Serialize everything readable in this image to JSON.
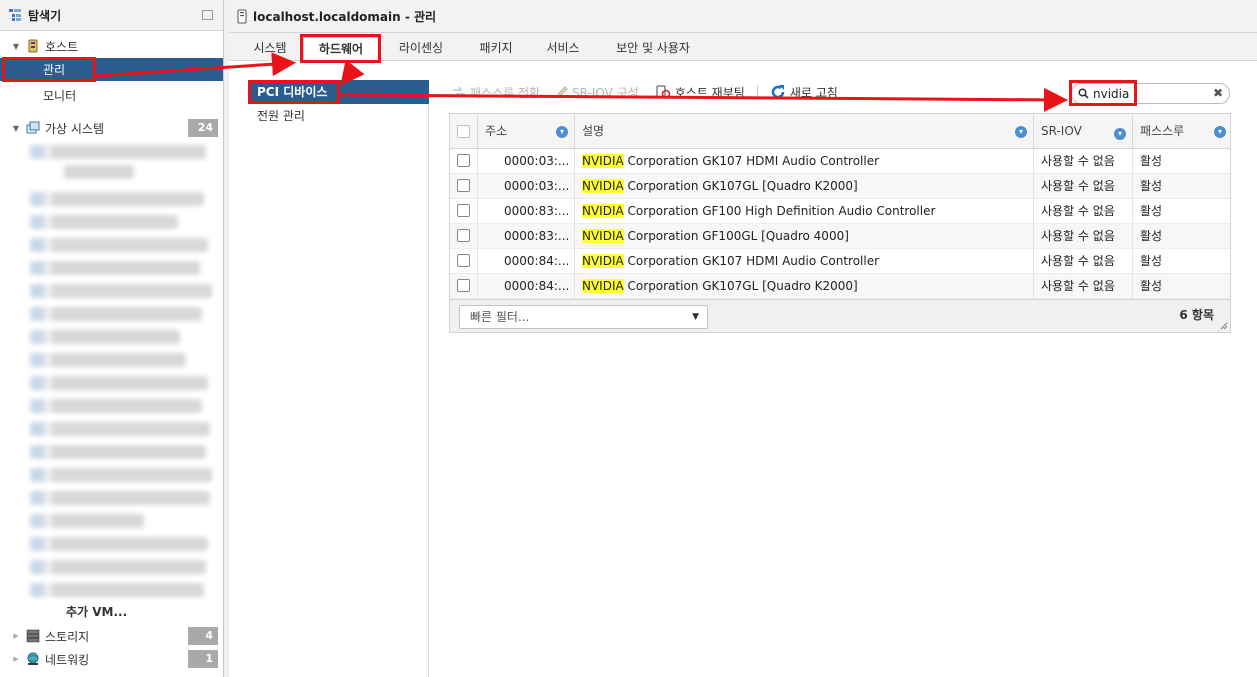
{
  "sidebar": {
    "title": "탐색기",
    "host": {
      "label": "호스트",
      "manage": "관리",
      "monitor": "모니터"
    },
    "vms": {
      "label": "가상 시스템",
      "count": "24",
      "more": "추가 VM..."
    },
    "storage": {
      "label": "스토리지",
      "count": "4"
    },
    "networking": {
      "label": "네트워킹",
      "count": "1"
    }
  },
  "header": {
    "title": "localhost.localdomain - 관리"
  },
  "tabs": [
    "시스템",
    "하드웨어",
    "라이센싱",
    "패키지",
    "서비스",
    "보안 및 사용자"
  ],
  "left_panel": [
    "PCI 디바이스",
    "전원 관리"
  ],
  "toolbar": {
    "passthrough": "패스스루 전환",
    "sriov": "SR-IOV 구성",
    "reboot": "호스트 재부팅",
    "refresh": "새로 고침"
  },
  "search": {
    "value": "nvidia"
  },
  "grid": {
    "columns": [
      "주소",
      "설명",
      "SR-IOV",
      "패스스루"
    ],
    "rows": [
      {
        "address": "0000:03:...",
        "vendor": "NVIDIA",
        "desc": " Corporation GK107 HDMI Audio Controller",
        "sriov": "사용할 수 없음",
        "passthrough": "활성"
      },
      {
        "address": "0000:03:...",
        "vendor": "NVIDIA",
        "desc": " Corporation GK107GL [Quadro K2000]",
        "sriov": "사용할 수 없음",
        "passthrough": "활성"
      },
      {
        "address": "0000:83:...",
        "vendor": "NVIDIA",
        "desc": " Corporation GF100 High Definition Audio Controller",
        "sriov": "사용할 수 없음",
        "passthrough": "활성"
      },
      {
        "address": "0000:83:...",
        "vendor": "NVIDIA",
        "desc": " Corporation GF100GL [Quadro 4000]",
        "sriov": "사용할 수 없음",
        "passthrough": "활성"
      },
      {
        "address": "0000:84:...",
        "vendor": "NVIDIA",
        "desc": " Corporation GK107 HDMI Audio Controller",
        "sriov": "사용할 수 없음",
        "passthrough": "활성"
      },
      {
        "address": "0000:84:...",
        "vendor": "NVIDIA",
        "desc": " Corporation GK107GL [Quadro K2000]",
        "sriov": "사용할 수 없음",
        "passthrough": "활성"
      }
    ],
    "filter_placeholder": "빠른 필터...",
    "item_count": "6 항목"
  },
  "colors": {
    "selected": "#2c5d8f",
    "annotation": "#e8141a",
    "highlight": "#ffff33",
    "sort_icon": "#4a8fd4"
  }
}
